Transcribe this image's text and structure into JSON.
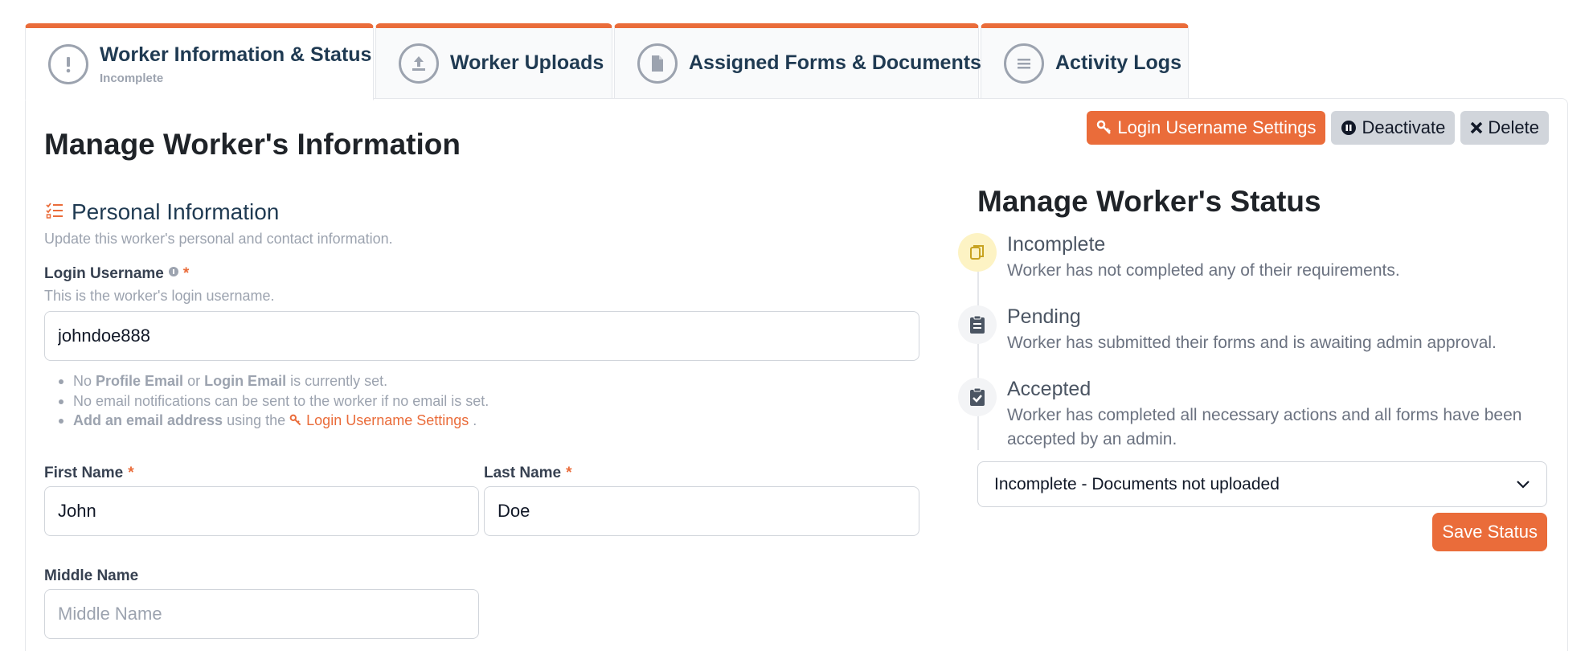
{
  "tabs": [
    {
      "label": "Worker Information & Status",
      "sub": "Incomplete",
      "icon": "exclamation-icon"
    },
    {
      "label": "Worker Uploads",
      "icon": "upload-icon"
    },
    {
      "label": "Assigned Forms & Documents",
      "icon": "document-icon"
    },
    {
      "label": "Activity Logs",
      "icon": "list-icon"
    }
  ],
  "page": {
    "title": "Manage Worker's Information"
  },
  "actions": {
    "login_settings": "Login Username Settings",
    "deactivate": "Deactivate",
    "delete": "Delete"
  },
  "personal": {
    "title": "Personal Information",
    "subtitle": "Update this worker's personal and contact information.",
    "login_label": "Login Username",
    "login_help": "This is the worker's login username.",
    "login_value": "johndoe888",
    "notes": {
      "n1_a": "No ",
      "n1_b": "Profile Email",
      "n1_c": " or ",
      "n1_d": "Login Email",
      "n1_e": " is currently set.",
      "n2": "No email notifications can be sent to the worker if no email is set.",
      "n3_a": "Add an email address",
      "n3_b": " using the ",
      "n3_link": "Login Username Settings",
      "n3_c": " ."
    },
    "first_label": "First Name",
    "first_value": "John",
    "last_label": "Last Name",
    "last_value": "Doe",
    "middle_label": "Middle Name",
    "middle_placeholder": "Middle Name",
    "required_mark": "*"
  },
  "status": {
    "title": "Manage Worker's Status",
    "items": [
      {
        "name": "Incomplete",
        "desc": "Worker has not completed any of their requirements."
      },
      {
        "name": "Pending",
        "desc": "Worker has submitted their forms and is awaiting admin approval."
      },
      {
        "name": "Accepted",
        "desc": "Worker has completed all necessary actions and all forms have been accepted by an admin."
      }
    ],
    "selected": "Incomplete - Documents not uploaded",
    "save_label": "Save Status"
  },
  "colors": {
    "accent": "#ea6c3a",
    "muted": "#9ca3af"
  }
}
